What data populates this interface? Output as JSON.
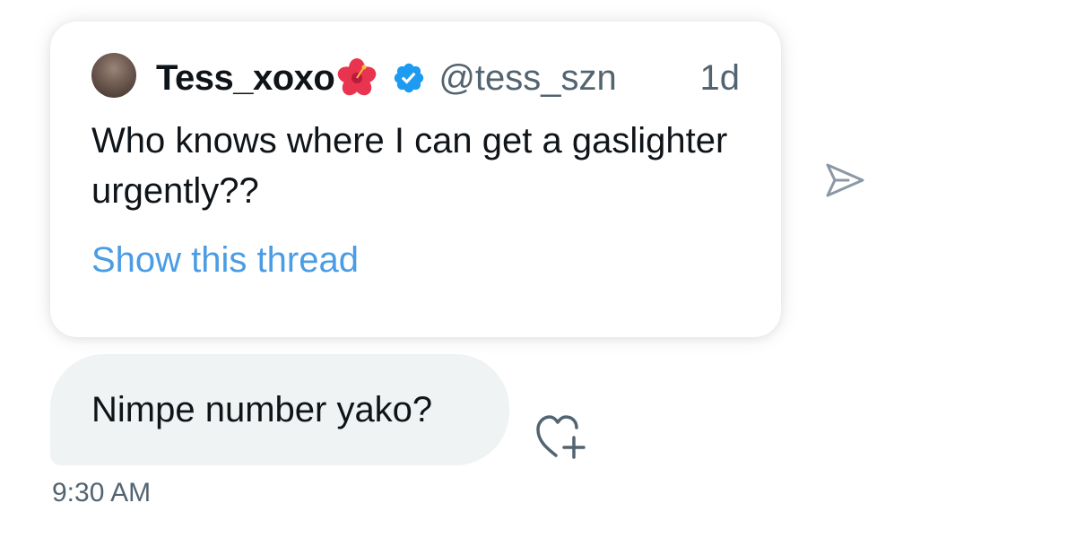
{
  "quoted_tweet": {
    "author_name": "Tess_xoxo",
    "author_emoji_icon": "hibiscus-icon",
    "verified_icon": "verified-badge-icon",
    "handle": "@tess_szn",
    "time_ago": "1d",
    "text": "Who knows where I can get a gaslighter urgently??",
    "show_thread_label": "Show this thread"
  },
  "message": {
    "text": "Nimpe number yako?",
    "time": "9:30 AM"
  },
  "icons": {
    "share": "send-icon",
    "react": "heart-plus-icon"
  },
  "colors": {
    "link": "#4a9ce4",
    "verified": "#1d9bf0",
    "bubble": "#eff3f4",
    "secondary_text": "#536471",
    "primary_text": "#0f1419"
  }
}
